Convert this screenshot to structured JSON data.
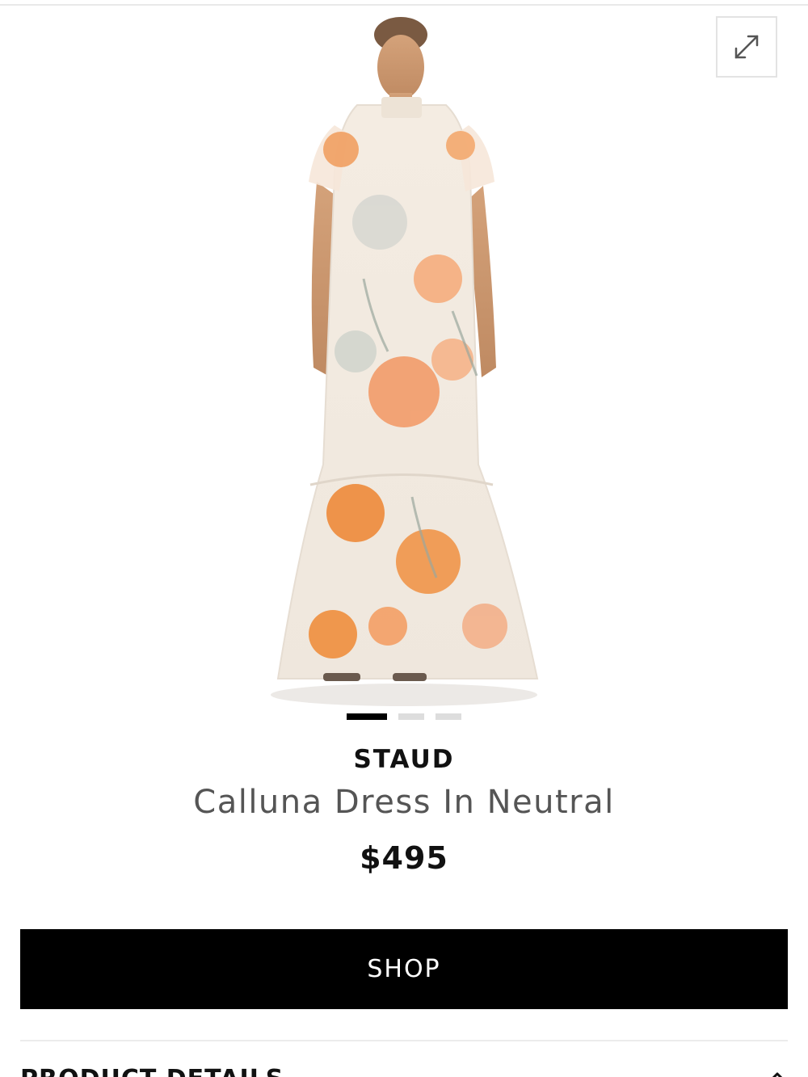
{
  "gallery": {
    "image_alt": "STAUD Calluna Dress In Neutral",
    "slide_count": 3,
    "active_slide": 1,
    "expand_icon": "expand-arrows-icon"
  },
  "product": {
    "brand": "STAUD",
    "name": "Calluna Dress In Neutral",
    "price": "$495"
  },
  "actions": {
    "shop_label": "SHOP"
  },
  "sections": {
    "details_label": "PRODUCT DETAILS",
    "details_icon": "chevron-up-icon"
  },
  "colors": {
    "button_bg": "#000000",
    "button_text": "#ffffff",
    "brand_text": "#111111",
    "name_text": "#555555",
    "dot_active": "#000000",
    "dot_inactive": "#dddddd"
  }
}
